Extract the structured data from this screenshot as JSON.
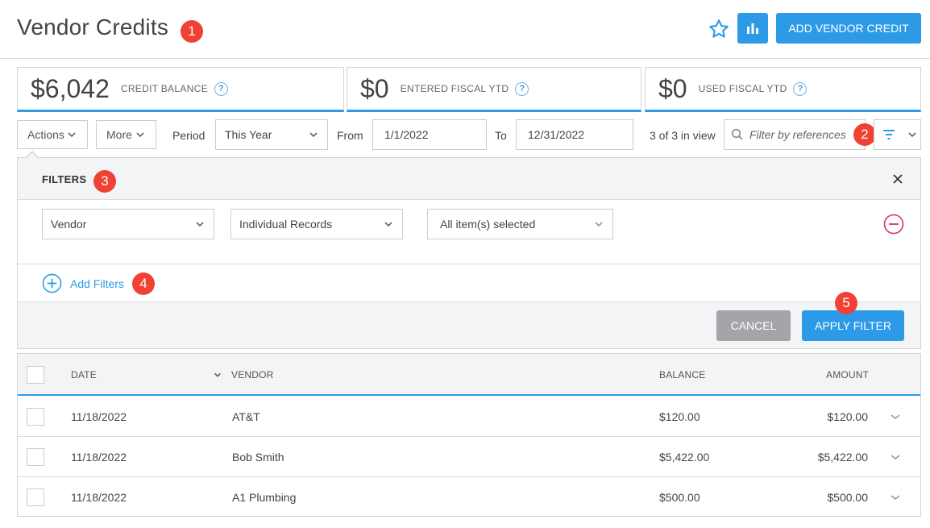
{
  "header": {
    "title": "Vendor Credits",
    "add_button": "ADD VENDOR CREDIT"
  },
  "badges": [
    "1",
    "2",
    "3",
    "4",
    "5"
  ],
  "cards": [
    {
      "value": "$6,042",
      "label": "CREDIT BALANCE"
    },
    {
      "value": "$0",
      "label": "ENTERED FISCAL YTD"
    },
    {
      "value": "$0",
      "label": "USED FISCAL YTD"
    }
  ],
  "toolbar": {
    "actions": "Actions",
    "more": "More",
    "period_label": "Period",
    "period_value": "This Year",
    "from_label": "From",
    "from_value": "1/1/2022",
    "to_label": "To",
    "to_value": "12/31/2022",
    "count": "3 of 3 in view",
    "search_placeholder": "Filter by references"
  },
  "filters": {
    "title": "FILTERS",
    "field": "Vendor",
    "mode": "Individual Records",
    "selection": "All item(s) selected",
    "add_label": "Add Filters",
    "cancel": "CANCEL",
    "apply": "APPLY FILTER"
  },
  "table": {
    "columns": [
      "DATE",
      "VENDOR",
      "BALANCE",
      "AMOUNT"
    ],
    "rows": [
      {
        "date": "11/18/2022",
        "vendor": "AT&T",
        "balance": "$120.00",
        "amount": "$120.00"
      },
      {
        "date": "11/18/2022",
        "vendor": "Bob Smith",
        "balance": "$5,422.00",
        "amount": "$5,422.00"
      },
      {
        "date": "11/18/2022",
        "vendor": "A1 Plumbing",
        "balance": "$500.00",
        "amount": "$500.00"
      }
    ]
  },
  "colors": {
    "accent": "#2d9ae8",
    "badge": "#f04134",
    "remove": "#d8345f"
  }
}
